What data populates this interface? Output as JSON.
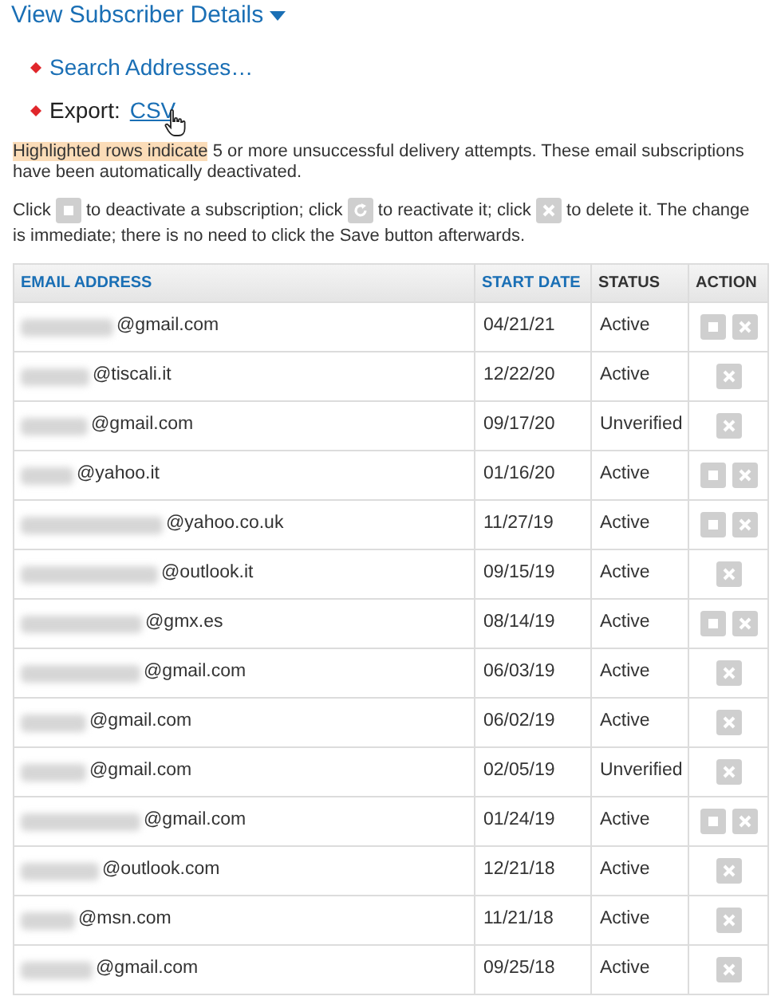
{
  "heading": {
    "label": "View Subscriber Details",
    "expanded": true
  },
  "links": [
    {
      "kind": "link",
      "label": "Search Addresses…"
    },
    {
      "kind": "export",
      "label": "Export:",
      "link": "CSV"
    }
  ],
  "notice": {
    "highlight": "Highlighted rows indicate",
    "rest": " 5 or more unsuccessful delivery attempts. These email subscriptions have been automatically deactivated."
  },
  "instructions": [
    "Click",
    "to deactivate a subscription; click",
    "to reactivate it; click",
    "to delete it. The change is immediate; there is no need to click the Save button afterwards."
  ],
  "table": {
    "columns": [
      {
        "label": "EMAIL ADDRESS",
        "sortable": true
      },
      {
        "label": "START DATE",
        "sortable": true
      },
      {
        "label": "STATUS",
        "sortable": false
      },
      {
        "label": "ACTION",
        "sortable": false
      }
    ],
    "rows": [
      {
        "email": "@gmail.com",
        "start_date": "04/21/21",
        "status": "Active",
        "can_deactivate": true
      },
      {
        "email": "@tiscali.it",
        "start_date": "12/22/20",
        "status": "Active",
        "can_deactivate": false
      },
      {
        "email": "@gmail.com",
        "start_date": "09/17/20",
        "status": "Unverified",
        "can_deactivate": false
      },
      {
        "email": "@yahoo.it",
        "start_date": "01/16/20",
        "status": "Active",
        "can_deactivate": true
      },
      {
        "email": "@yahoo.co.uk",
        "start_date": "11/27/19",
        "status": "Active",
        "can_deactivate": true
      },
      {
        "email": "@outlook.it",
        "start_date": "09/15/19",
        "status": "Active",
        "can_deactivate": false
      },
      {
        "email": "@gmx.es",
        "start_date": "08/14/19",
        "status": "Active",
        "can_deactivate": true
      },
      {
        "email": "@gmail.com",
        "start_date": "06/03/19",
        "status": "Active",
        "can_deactivate": false
      },
      {
        "email": "@gmail.com",
        "start_date": "06/02/19",
        "status": "Active",
        "can_deactivate": false
      },
      {
        "email": "@gmail.com",
        "start_date": "02/05/19",
        "status": "Unverified",
        "can_deactivate": false
      },
      {
        "email": "@gmail.com",
        "start_date": "01/24/19",
        "status": "Active",
        "can_deactivate": true
      },
      {
        "email": "@outlook.com",
        "start_date": "12/21/18",
        "status": "Active",
        "can_deactivate": false
      },
      {
        "email": "@msn.com",
        "start_date": "11/21/18",
        "status": "Active",
        "can_deactivate": false
      },
      {
        "email": "@gmail.com",
        "start_date": "09/25/18",
        "status": "Active",
        "can_deactivate": false
      }
    ]
  }
}
